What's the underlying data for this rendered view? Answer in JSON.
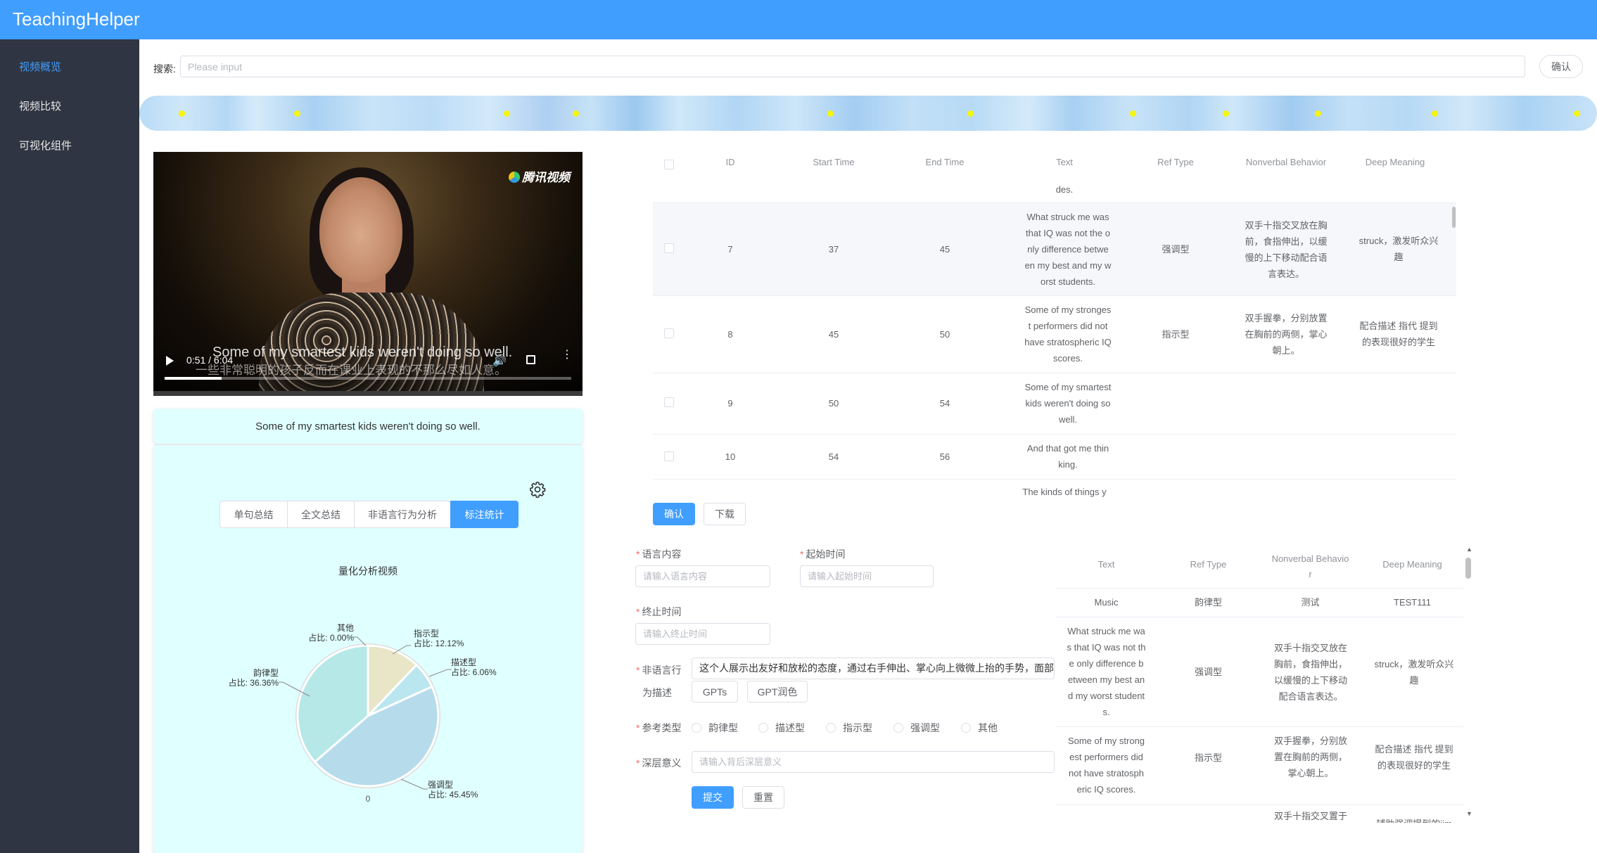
{
  "app": {
    "title": "TeachingHelper"
  },
  "sidebar": {
    "items": [
      {
        "label": "视频概览",
        "active": true
      },
      {
        "label": "视频比较",
        "active": false
      },
      {
        "label": "可视化组件",
        "active": false
      }
    ]
  },
  "search": {
    "label": "搜索:",
    "placeholder": "Please input",
    "value": "",
    "confirm": "确认"
  },
  "timeline": {
    "accent": "#f5f50e",
    "markers": 14
  },
  "video": {
    "brand": "腾讯视频",
    "subtitle_en": "Some of my smartest kids weren't doing so well.",
    "subtitle_zh": "一些非常聪明的孩子反而在课业上表现的不那么尽如人意。",
    "time": "0:51 / 6:04",
    "progress": 0.141,
    "icons": [
      "play-icon",
      "volume-icon",
      "fullscreen-icon",
      "more-icon"
    ]
  },
  "caption": "Some of my smartest kids weren't doing so well.",
  "analysis": {
    "tabs": [
      {
        "label": "单句总结",
        "active": false
      },
      {
        "label": "全文总结",
        "active": false
      },
      {
        "label": "非语言行为分析",
        "active": false
      },
      {
        "label": "标注统计",
        "active": true
      }
    ],
    "chart_title": "量化分析视频"
  },
  "chart_data": {
    "type": "pie",
    "title": "量化分析视频",
    "slices": [
      {
        "name": "指示型",
        "pct_label": "占比: 12.12%",
        "value": 12.12,
        "color": "#e8e6c6"
      },
      {
        "name": "描述型",
        "pct_label": "占比: 6.06%",
        "value": 6.06,
        "color": "#b9e6ef"
      },
      {
        "name": "强调型",
        "pct_label": "占比: 45.45%",
        "value": 45.45,
        "color": "#b6dcec"
      },
      {
        "name": "韵律型",
        "pct_label": "占比: 36.36%",
        "value": 36.36,
        "color": "#b6e8e8"
      },
      {
        "name": "其他",
        "pct_label": "占比: 0.00%",
        "value": 0.0,
        "color": "#f2d6c6"
      }
    ],
    "zero_label": "0"
  },
  "table1": {
    "headers": [
      "ID",
      "Start Time",
      "End Time",
      "Text",
      "Ref Type",
      "Nonverbal Behavior",
      "Deep Meaning"
    ],
    "top_fragment": "des.",
    "rows": [
      {
        "id": "7",
        "start": "37",
        "end": "45",
        "text": [
          "What struck me was",
          "that IQ was not the o",
          "nly difference betwe",
          "en my best and my w",
          "orst students."
        ],
        "ref": "强调型",
        "nonverbal": [
          "双手十指交叉放在胸",
          "前，食指伸出，以缓",
          "慢的上下移动配合语",
          "言表达。"
        ],
        "deep": [
          "struck，激发听众兴",
          "趣"
        ]
      },
      {
        "id": "8",
        "start": "45",
        "end": "50",
        "text": [
          "Some of my stronges",
          "t performers did not",
          "have stratospheric IQ",
          "scores."
        ],
        "ref": "指示型",
        "nonverbal": [
          "双手握拳，分别放置",
          "在胸前的两侧，掌心",
          "朝上。"
        ],
        "deep": [
          "配合描述 指代 提到",
          "的表现很好的学生"
        ]
      },
      {
        "id": "9",
        "start": "50",
        "end": "54",
        "text": [
          "Some of my smartest",
          "kids weren't doing so",
          "well."
        ],
        "ref": "",
        "nonverbal": [],
        "deep": []
      },
      {
        "id": "10",
        "start": "54",
        "end": "56",
        "text": [
          "And that got me thin",
          "king."
        ],
        "ref": "",
        "nonverbal": [],
        "deep": []
      }
    ],
    "bottom_fragment": "The kinds of things y",
    "confirm": "确认",
    "download": "下载"
  },
  "form": {
    "speech_label": "语言内容",
    "speech_placeholder": "请输入语言内容",
    "start_label": "起始时间",
    "start_placeholder": "请输入起始时间",
    "end_label": "终止时间",
    "end_placeholder": "请输入终止时间",
    "nonverbal_label_1": "非语言行",
    "nonverbal_label_2": "为描述",
    "nonverbal_value": "这个人展示出友好和放松的态度，通过右手伸出、掌心向上微微上抬的手势，面部",
    "gpts": "GPTs",
    "gpt_polish": "GPT润色",
    "ref_label": "参考类型",
    "ref_options": [
      "韵律型",
      "描述型",
      "指示型",
      "强调型",
      "其他"
    ],
    "deep_label": "深层意义",
    "deep_placeholder": "请输入背后深层意义",
    "submit": "提交",
    "reset": "重置"
  },
  "table2": {
    "headers": [
      "Text",
      "Ref Type",
      "Nonverbal Behavio",
      "r",
      "Deep Meaning"
    ],
    "rows": [
      {
        "text": [
          "Music"
        ],
        "ref": "韵律型",
        "nonverbal": [
          "测试"
        ],
        "deep": [
          "TEST111"
        ]
      },
      {
        "text": [
          "What struck me wa",
          "s that IQ was not th",
          "e only difference b",
          "etween my best an",
          "d my worst student",
          "s."
        ],
        "ref": "强调型",
        "nonverbal": [
          "双手十指交叉放在",
          "胸前，食指伸出，",
          "以缓慢的上下移动",
          "配合语言表达。"
        ],
        "deep": [
          "struck，激发听众兴",
          "趣"
        ]
      },
      {
        "text": [
          "Some of my strong",
          "est performers did",
          "not have stratosph",
          "eric IQ scores."
        ],
        "ref": "指示型",
        "nonverbal": [
          "双手握拳，分别放",
          "置在胸前的两侧，",
          "掌心朝上。"
        ],
        "deep": [
          "配合描述 指代 提到",
          "的表现很好的学生"
        ]
      }
    ],
    "partial_nonverbal": "双手十指交叉置于",
    "partial_deep": "辅助强调提到的iim"
  }
}
